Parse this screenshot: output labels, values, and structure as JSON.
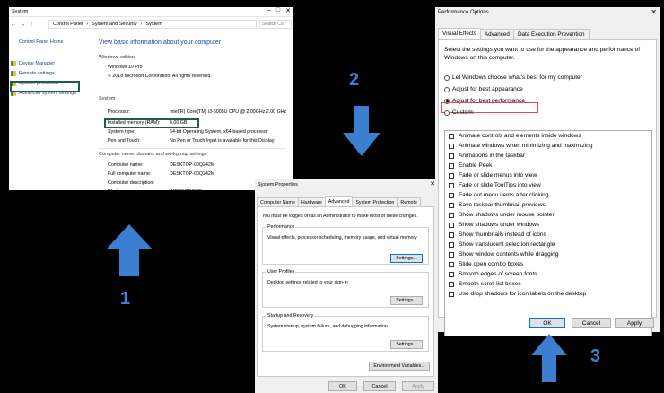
{
  "step_labels": [
    "1",
    "2",
    "3"
  ],
  "colors": {
    "arrow": "#3c7fd0",
    "highlight_green": "#1f5c4b",
    "highlight_red": "#e44a4a",
    "link": "#1a3f8a"
  },
  "system_window": {
    "title": "System",
    "breadcrumb": [
      "Control Panel",
      "System and Security",
      "System"
    ],
    "search_placeholder": "Search Co",
    "sidebar": {
      "home": "Control Panel Home",
      "items": [
        "Device Manager",
        "Remote settings",
        "System protection",
        "Advanced system settings"
      ]
    },
    "heading": "View basic information about your computer",
    "edition_section": "Windows edition",
    "edition": "Windows 10 Pro",
    "copyright": "© 2018 Microsoft Corporation. All rights reserved.",
    "system_section": "System",
    "system_rows": [
      {
        "label": "Processor:",
        "value": "Intel(R) Core(TM) i3-5005U CPU @ 2.00GHz   2.00 GHz"
      },
      {
        "label": "Installed memory (RAM):",
        "value": "4.00 GB"
      },
      {
        "label": "System type:",
        "value": "64-bit Operating System, x64-based processor"
      },
      {
        "label": "Pen and Touch:",
        "value": "No Pen or Touch Input is available for this Display"
      }
    ],
    "computer_section": "Computer name, domain, and workgroup settings",
    "computer_rows": [
      {
        "label": "Computer name:",
        "value": "DESKTOP-00Q242M"
      },
      {
        "label": "Full computer name:",
        "value": "DESKTOP-00Q242M"
      },
      {
        "label": "Computer description:",
        "value": ""
      },
      {
        "label": "Workgroup:",
        "value": "WORKGROUP"
      }
    ]
  },
  "system_properties": {
    "title": "System Properties",
    "tabs": [
      "Computer Name",
      "Hardware",
      "Advanced",
      "System Protection",
      "Remote"
    ],
    "active_tab": "Advanced",
    "admin_note": "You must be logged on as an Administrator to make most of these changes.",
    "groups": [
      {
        "label": "Performance",
        "desc": "Visual effects, processor scheduling, memory usage, and virtual memory",
        "button": "Settings..."
      },
      {
        "label": "User Profiles",
        "desc": "Desktop settings related to your sign-in",
        "button": "Settings..."
      },
      {
        "label": "Startup and Recovery",
        "desc": "System startup, system failure, and debugging information",
        "button": "Settings..."
      }
    ],
    "env_button": "Environment Variables...",
    "buttons": [
      "OK",
      "Cancel",
      "Apply"
    ]
  },
  "performance_options": {
    "title": "Performance Options",
    "tabs": [
      "Visual Effects",
      "Advanced",
      "Data Execution Prevention"
    ],
    "active_tab": "Visual Effects",
    "description": "Select the settings you want to use for the appearance and performance of Windows on this computer.",
    "radios": [
      {
        "label": "Let Windows choose what's best for my computer",
        "selected": false
      },
      {
        "label": "Adjust for best appearance",
        "selected": false
      },
      {
        "label": "Adjust for best performance",
        "selected": true
      },
      {
        "label": "Custom:",
        "selected": false
      }
    ],
    "effects": [
      "Animate controls and elements inside windows",
      "Animate windows when minimizing and maximizing",
      "Animations in the taskbar",
      "Enable Peek",
      "Fade or slide menus into view",
      "Fade or slide ToolTips into view",
      "Fade out menu items after clicking",
      "Save taskbar thumbnail previews",
      "Show shadows under mouse pointer",
      "Show shadows under windows",
      "Show thumbnails instead of icons",
      "Show translucent selection rectangle",
      "Show window contents while dragging",
      "Slide open combo boxes",
      "Smooth edges of screen fonts",
      "Smooth-scroll list boxes",
      "Use drop shadows for icon labels on the desktop"
    ],
    "buttons": [
      "OK",
      "Cancel",
      "Apply"
    ]
  }
}
